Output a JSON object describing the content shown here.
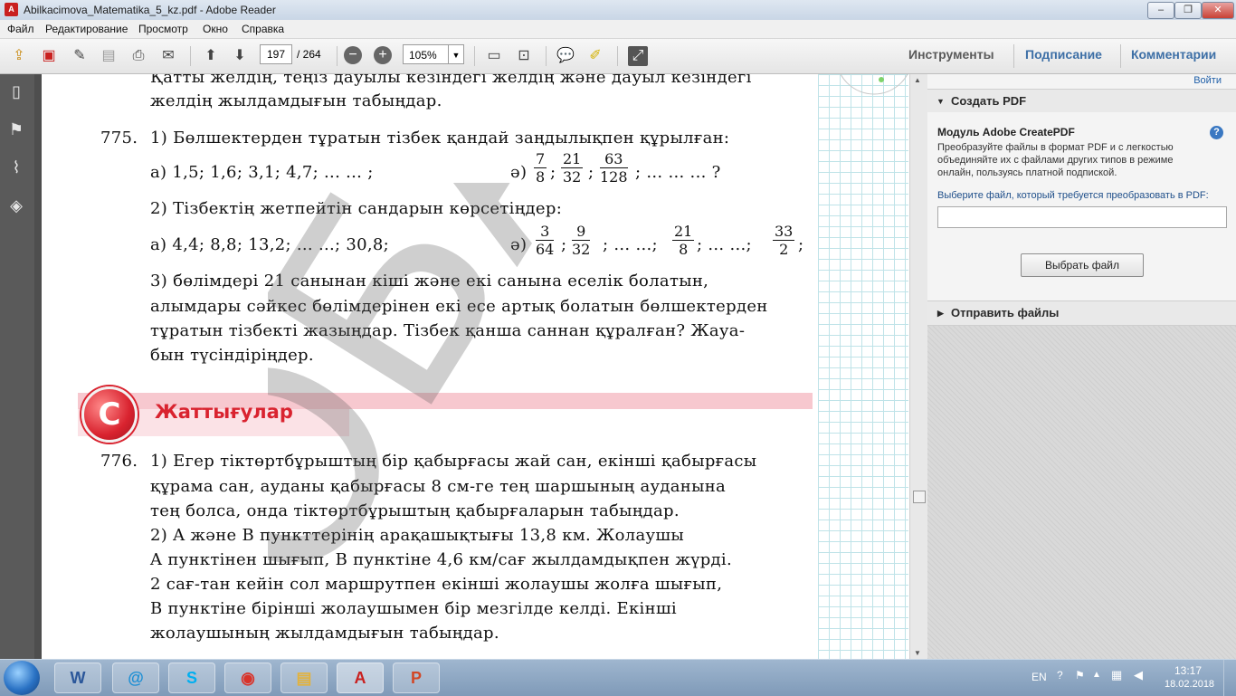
{
  "window": {
    "title": "Abilkacimova_Matematika_5_kz.pdf - Adobe Reader",
    "controls": [
      "–",
      "❐",
      "✕"
    ]
  },
  "menu": [
    "Файл",
    "Редактирование",
    "Просмотр",
    "Окно",
    "Справка"
  ],
  "toolbar": {
    "page_current": "197",
    "page_total": "/ 264",
    "zoom": "105%",
    "links": {
      "tools": "Инструменты",
      "sign": "Подписание",
      "comment": "Комментарии"
    }
  },
  "document": {
    "line_top_1": "Қатты желдің, теңіз дауылы кезіндегі желдің және дауыл кезіндегі",
    "line_top_2": "желдің жылдамдығын табыңдар.",
    "p775_num": "775.",
    "p775_q1": "1) Бөлшектерден тұратын тізбек қандай заңдылықпен құрылған:",
    "p775_a": "а) 1,5; 1,6; 3,1; 4,7; ... ... ;",
    "p775_ae_label": "ә)",
    "frac1": {
      "num": "7",
      "den": "8"
    },
    "frac2": {
      "num": "21",
      "den": "32"
    },
    "frac3": {
      "num": "63",
      "den": "128"
    },
    "p775_ae_tail": "; ... ... ... ?",
    "p775_q2": "2) Тізбектің жетпейтін сандарын көрсетіңдер:",
    "p775_a2": "а) 4,4; 8,8; 13,2; ... ...; 30,8;",
    "p775_ae2_label": "ә)",
    "frac4": {
      "num": "3",
      "den": "64"
    },
    "frac5": {
      "num": "9",
      "den": "32"
    },
    "p775_mid": "; ... ...;",
    "frac6": {
      "num": "21",
      "den": "8"
    },
    "p775_mid2": "; ... ...;",
    "frac7": {
      "num": "33",
      "den": "2"
    },
    "p775_q3_1": "3) бөлімдері 21 санынан кіші және екі санына еселік болатын,",
    "p775_q3_2": "алымдары сәйкес бөлімдерінен екі есе артық болатын бөлшектерден",
    "p775_q3_3": "тұратын тізбекті жазыңдар. Тізбек қанша саннан құралған? Жауа-",
    "p775_q3_4": "бын түсіндіріңдер.",
    "exercise_icon": "C",
    "exercise_title": "Жаттығулар",
    "p776_num": "776.",
    "p776_1": "1) Егер тіктөртбұрыштың бір қабырғасы жай сан, екінші қабырғасы",
    "p776_2": "құрама сан, ауданы қабырғасы 8 см-ге тең шаршының ауданына",
    "p776_3": "тең болса, онда тіктөртбұрыштың қабырғаларын табыңдар.",
    "p776_4": "2) A және B пункттерінің арақашықтығы 13,8 км. Жолаушы",
    "p776_5": "A пунктінен шығып, B пунктіне 4,6 км/сағ жылдамдықпен жүрді.",
    "p776_6": "2 сағ-тан кейін сол маршрутпен екінші жолаушы жолға шығып,",
    "p776_7": "B пунктіне бірінші жолаушымен бір мезгілде келді. Екінші",
    "p776_8": "жолаушының жылдамдығын табыңдар.",
    "watermark": "ОБА"
  },
  "right_panel": {
    "login": "Войти",
    "create_pdf": "Создать PDF",
    "module_title": "Модуль Adobe CreatePDF",
    "module_desc_1": "Преобразуйте файлы в формат PDF и с легкостью",
    "module_desc_2": "объединяйте их с файлами других типов в режиме",
    "module_desc_3": "онлайн, пользуясь платной подпиской.",
    "select_prompt": "Выберите файл, который требуется преобразовать в PDF:",
    "select_button": "Выбрать файл",
    "send_files": "Отправить файлы"
  },
  "taskbar": {
    "lang": "EN",
    "time": "13:17",
    "date": "18.02.2018"
  },
  "colors": {
    "accent_red": "#d9232f",
    "link_blue": "#1f5fa8",
    "taskbar": "#8aa6c4"
  }
}
